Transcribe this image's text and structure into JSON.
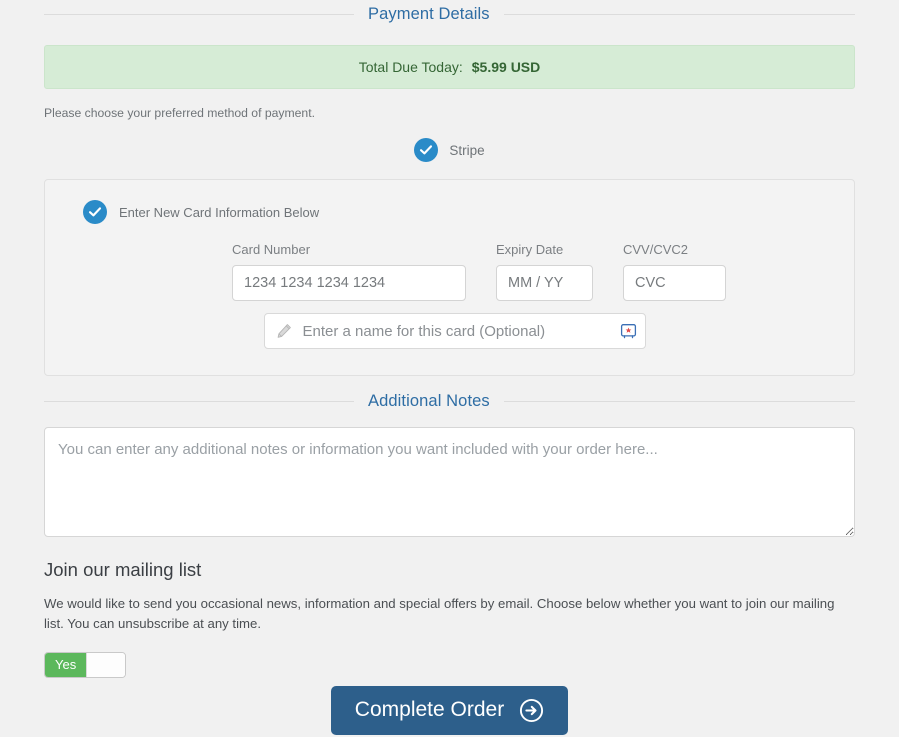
{
  "payment_section": {
    "header": "Payment Details",
    "total_label": "Total Due Today:",
    "total_amount": "$5.99 USD",
    "help_text": "Please choose your preferred method of payment.",
    "gateway": {
      "label": "Stripe",
      "selected": true,
      "icon": "check-circle-icon"
    }
  },
  "card_panel": {
    "new_card_label": "Enter New Card Information Below",
    "new_card_selected": true,
    "fields": {
      "card_number": {
        "label": "Card Number",
        "placeholder": "1234 1234 1234 1234",
        "value": ""
      },
      "expiry": {
        "label": "Expiry Date",
        "placeholder": "MM / YY",
        "value": ""
      },
      "cvv": {
        "label": "CVV/CVC2",
        "placeholder": "CVC",
        "value": ""
      },
      "card_name": {
        "placeholder": "Enter a name for this card (Optional)",
        "value": "",
        "left_icon": "pencil-icon",
        "right_icon": "autofill-icon"
      }
    }
  },
  "notes_section": {
    "header": "Additional Notes",
    "placeholder": "You can enter any additional notes or information you want included with your order here...",
    "value": ""
  },
  "mailing_list": {
    "title": "Join our mailing list",
    "description": "We would like to send you occasional news, information and special offers by email. Choose below whether you want to join our mailing list. You can unsubscribe at any time.",
    "toggle_state": "Yes"
  },
  "submit": {
    "label": "Complete Order",
    "icon": "arrow-right-circle-icon"
  },
  "colors": {
    "accent_blue": "#2a8bc8",
    "header_blue": "#2e6da4",
    "success_green": "#5cb85c",
    "banner_bg": "#d6ecd6",
    "banner_text": "#356635",
    "button_blue": "#2d5f8b",
    "page_bg": "#f1f1f1"
  }
}
